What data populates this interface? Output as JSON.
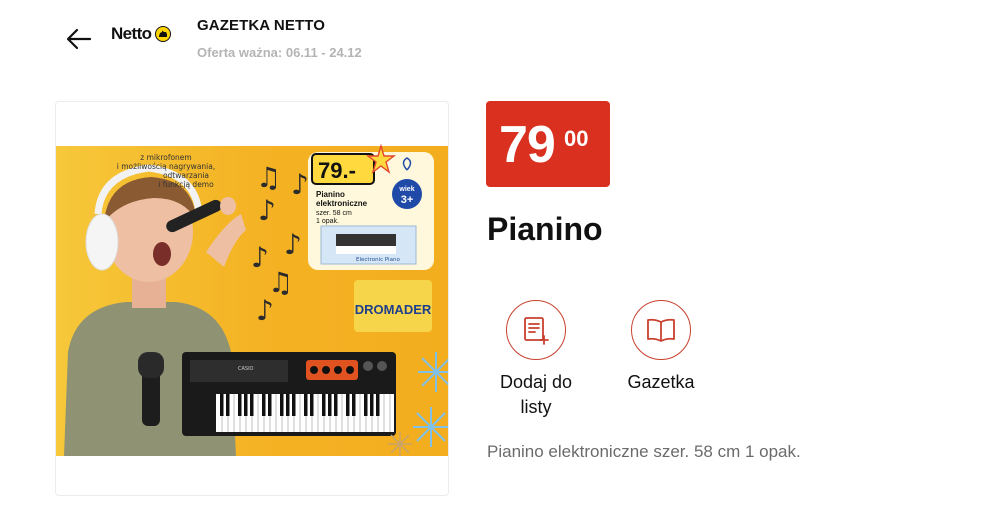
{
  "header": {
    "back_icon": "arrow-left-icon",
    "brand_name": "Netto",
    "title": "GAZETKA NETTO",
    "validity": "Oferta ważna: 06.11 - 24.12"
  },
  "product": {
    "price_main": "79",
    "price_cents": "00",
    "name": "Pianino",
    "description": "Pianino elektroniczne szer. 58 cm 1 opak.",
    "image": {
      "caption": "z mikrofonem i możliwością nagrywania, odtwarzania i funkcją demo",
      "promo_price": "79.-",
      "promo_title": "Pianino elektroniczne",
      "promo_detail1": "szer. 58 cm",
      "promo_detail2": "1 opak.",
      "age_label": "wiek",
      "age_value": "3+",
      "box_label": "Electronic Piano",
      "brand": "DROMADER",
      "keyboard_brand": "CASIO"
    }
  },
  "actions": [
    {
      "label": "Dodaj do listy",
      "icon": "add-to-list-icon"
    },
    {
      "label": "Gazetka",
      "icon": "book-icon"
    }
  ],
  "colors": {
    "accent": "#d9301f",
    "icon_stroke": "#c9402e",
    "muted": "#b4b4b4",
    "banner_yellow": "#f4b324"
  }
}
